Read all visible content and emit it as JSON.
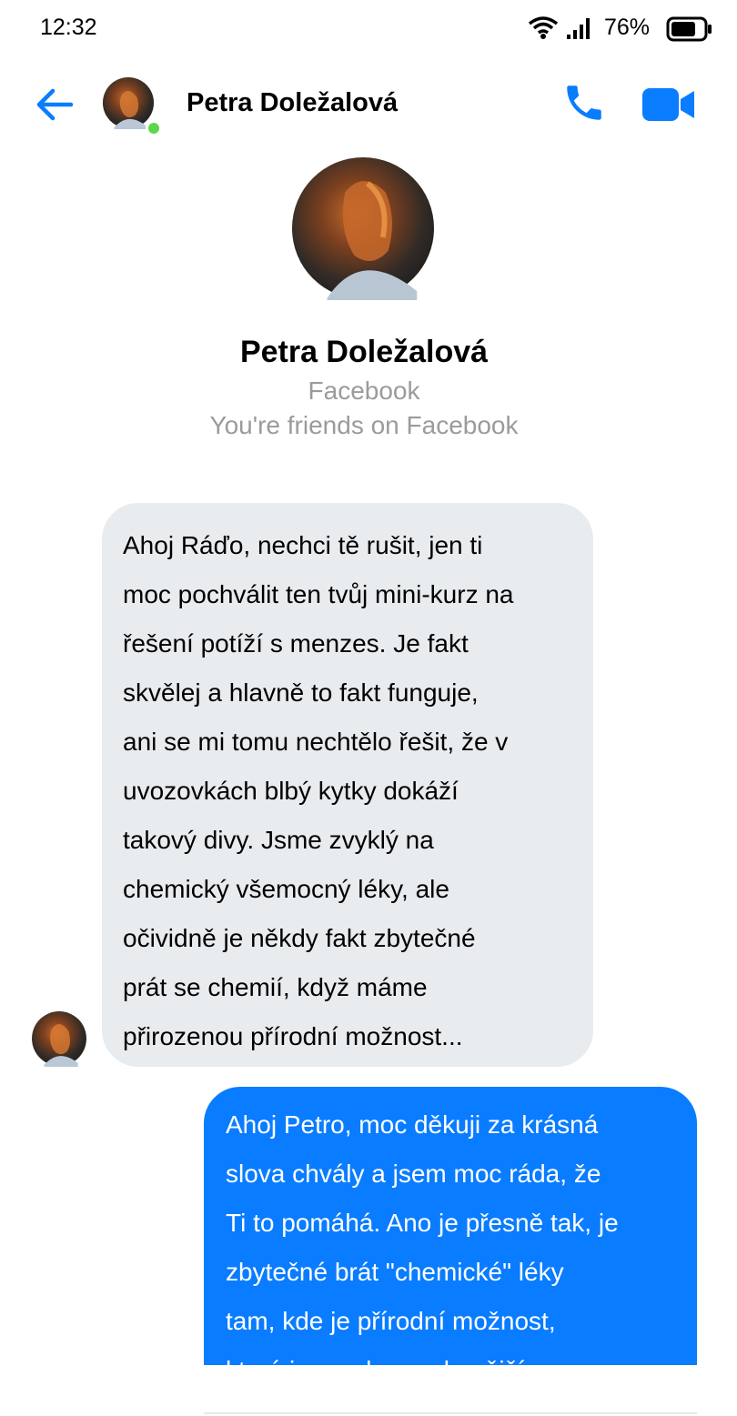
{
  "status_bar": {
    "time": "12:32",
    "battery": "76%"
  },
  "header": {
    "contact_name": "Petra Doležalová",
    "online": true
  },
  "profile": {
    "name": "Petra Doležalová",
    "source": "Facebook",
    "relationship": "You're friends on Facebook"
  },
  "messages": [
    {
      "direction": "incoming",
      "lines": [
        "Ahoj Ráďo, nechci tě rušit, jen ti",
        "moc pochválit ten tvůj mini-kurz na",
        "řešení potíží s menzes. Je fakt",
        "skvělej a hlavně to fakt funguje,",
        "ani se mi tomu nechtělo řešit, že v",
        "uvozovkách blbý kytky dokáží",
        "takový divy. Jsme zvyklý na",
        "chemický všemocný léky, ale",
        "očividně je někdy fakt zbytečné",
        "prát se chemií, když máme",
        "přirozenou přírodní možnost..."
      ]
    },
    {
      "direction": "outgoing",
      "lines": [
        "Ahoj Petro, moc děkuji za krásná",
        "slova chvály a jsem moc ráda, že",
        "Ti to pomáhá. Ano je přesně tak, je",
        "zbytečné brát \"chemické\" léky",
        "tam, kde je přírodní možnost,",
        "která je mnohem zdravější a"
      ]
    }
  ],
  "colors": {
    "accent": "#0a7cff",
    "incoming_bubble": "#e9ecef",
    "online_dot": "#5ad84b",
    "muted_text": "#9b9b9b"
  },
  "icons": [
    "wifi-icon",
    "signal-icon",
    "battery-icon",
    "back-arrow-icon",
    "phone-icon",
    "video-camera-icon"
  ]
}
